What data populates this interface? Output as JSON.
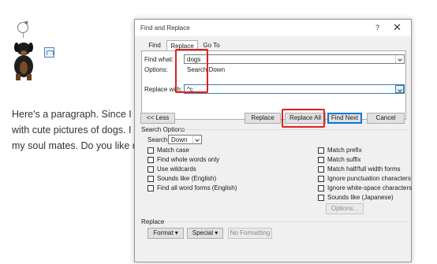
{
  "document": {
    "para_lines": [
      "Here's a paragraph. Since I lo",
      "with cute pictures of dogs. I",
      "my soul mates. Do you like d"
    ]
  },
  "dialog": {
    "title": "Find and Replace",
    "help": "?",
    "close": "✕",
    "tabs": [
      "Find",
      "Replace",
      "Go To"
    ],
    "find_what_label": "Find what:",
    "find_what_value": "dogs",
    "options_label": "Options:",
    "options_value": "Search Down",
    "replace_with_label": "Replace with:",
    "replace_with_value": "^c",
    "buttons": {
      "less": "<< Less",
      "replace": "Replace",
      "replace_all": "Replace All",
      "find_next": "Find Next",
      "cancel": "Cancel"
    },
    "search_options_title": "Search Options",
    "search_label": "Search:",
    "search_value": "Down",
    "left_checks": [
      "Match case",
      "Find whole words only",
      "Use wildcards",
      "Sounds like (English)",
      "Find all word forms (English)"
    ],
    "right_checks": [
      "Match prefix",
      "Match suffix",
      "Match half/full width forms",
      "Ignore punctuation characters",
      "Ignore white-space characters",
      "Sounds like (Japanese)"
    ],
    "options_button": "Options...",
    "replace_section_title": "Replace",
    "format_button": "Format",
    "special_button": "Special",
    "no_formatting_button": "No Formatting"
  },
  "colors": {
    "highlight": "#e02020",
    "accent": "#0078d7"
  }
}
